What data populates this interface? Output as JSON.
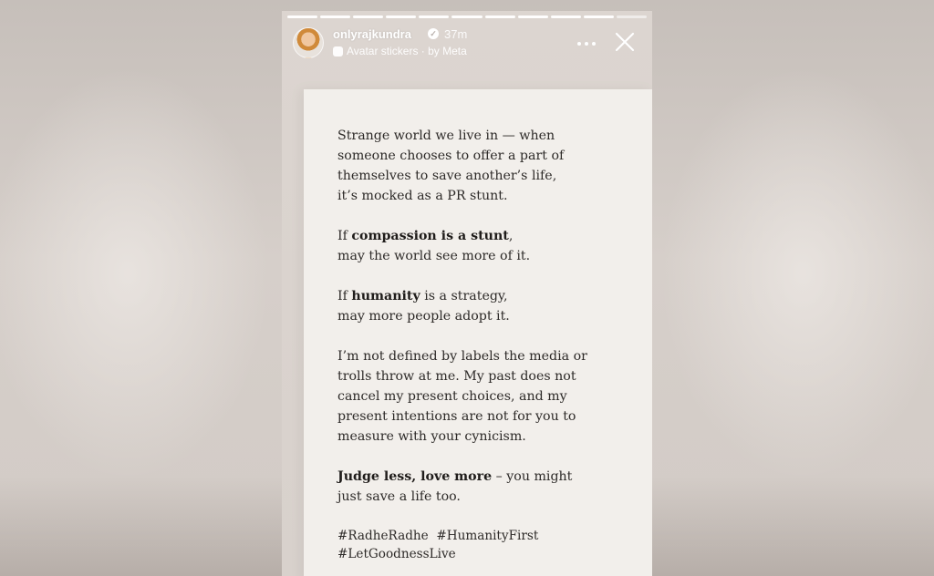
{
  "story": {
    "progress_total": 11,
    "progress_done": 10,
    "username": "onlyrajkundra",
    "time": "37m",
    "subline": "Avatar stickers · by Meta",
    "icons": {
      "avatar": "avatar",
      "verified": "verified-badge-icon",
      "more": "more-icon",
      "close": "close-icon",
      "sticker": "sticker-icon"
    }
  },
  "post": {
    "p1": {
      "l1": "Strange world we live in — when",
      "l2": "someone chooses to offer a part of",
      "l3": "themselves to save another’s life,",
      "l4": "it’s mocked as a PR stunt."
    },
    "p2": {
      "l1_pre": "If ",
      "l1_bold": "compassion is a stunt",
      "l1_post": ",",
      "l2": "may the world see more of it."
    },
    "p3": {
      "l1_pre": "If ",
      "l1_bold": "humanity",
      "l1_post": " is a strategy,",
      "l2": "may more people adopt it."
    },
    "p4": {
      "l1": "I’m not defined by labels the media or",
      "l2": "trolls throw at me. My past does not",
      "l3": "cancel my present choices, and my",
      "l4": "present intentions are not for you to",
      "l5": "measure with your cynicism."
    },
    "p5": {
      "l1_bold": "Judge less, love more",
      "l1_post": " – you might",
      "l2": "just save a life too."
    },
    "tags": {
      "l1": "#RadheRadhe  #HumanityFirst",
      "l2": "#LetGoodnessLive"
    }
  }
}
